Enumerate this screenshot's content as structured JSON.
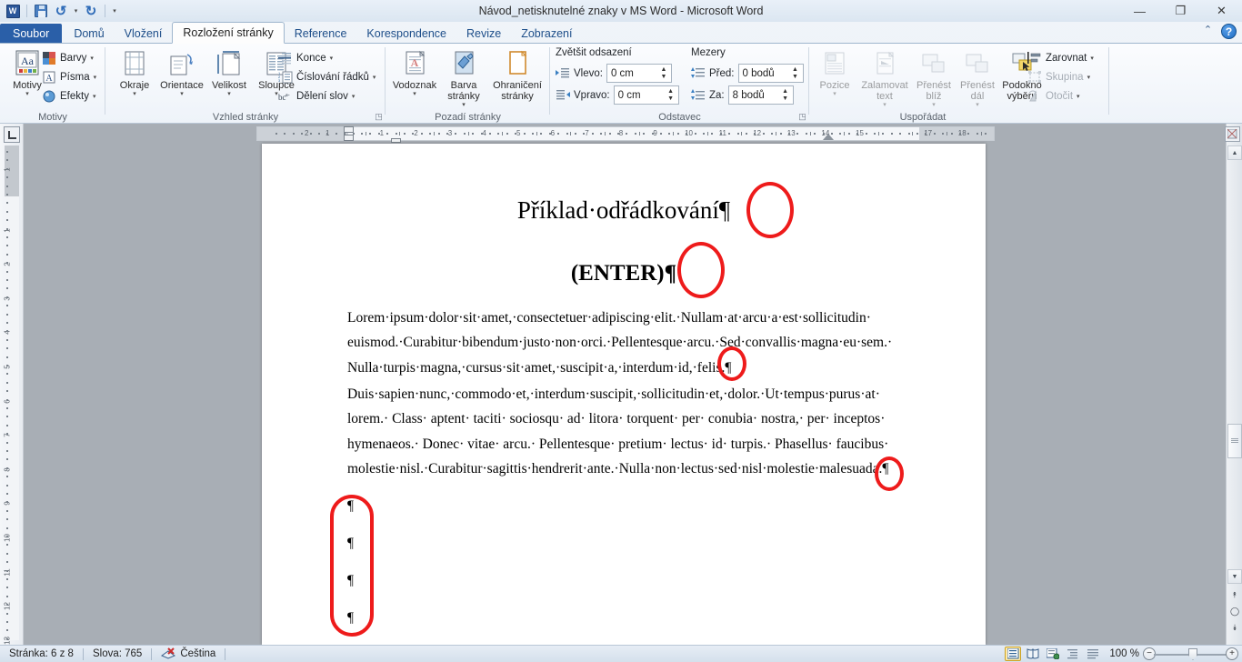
{
  "window": {
    "title": "Návod_netisknutelné znaky v MS Word  -  Microsoft Word",
    "minimize": "—",
    "restore": "❐",
    "close": "✕"
  },
  "quick_access": {
    "word_logo": "W",
    "save": "save-icon",
    "undo": "↺",
    "undo_caret": "▾",
    "redo": "↻",
    "customize_caret": "▾"
  },
  "tabs": [
    {
      "label": "Soubor",
      "active": false,
      "kind": "file"
    },
    {
      "label": "Domů",
      "active": false
    },
    {
      "label": "Vložení",
      "active": false
    },
    {
      "label": "Rozložení stránky",
      "active": true
    },
    {
      "label": "Reference",
      "active": false
    },
    {
      "label": "Korespondence",
      "active": false
    },
    {
      "label": "Revize",
      "active": false
    },
    {
      "label": "Zobrazení",
      "active": false
    }
  ],
  "help": {
    "minimize_ribbon": "⌃",
    "help_label": "?"
  },
  "ribbon": {
    "groups": [
      {
        "name": "Motivy",
        "big": [
          {
            "label": "Motivy",
            "caret": "▾"
          }
        ],
        "small": [
          {
            "label": "Barvy",
            "caret": "▾",
            "disabled": false
          },
          {
            "label": "Písma",
            "caret": "▾",
            "disabled": false
          },
          {
            "label": "Efekty",
            "caret": "▾",
            "disabled": false
          }
        ]
      },
      {
        "name": "Vzhled stránky",
        "big": [
          {
            "label": "Okraje",
            "caret": "▾"
          },
          {
            "label": "Orientace",
            "caret": "▾"
          },
          {
            "label": "Velikost",
            "caret": "▾"
          },
          {
            "label": "Sloupce",
            "caret": "▾"
          }
        ],
        "small": [
          {
            "label": "Konce",
            "caret": "▾"
          },
          {
            "label": "Číslování řádků",
            "caret": "▾"
          },
          {
            "label": "Dělení slov",
            "caret": "▾"
          }
        ],
        "dialog_launcher": "◳"
      },
      {
        "name": "Pozadí stránky",
        "big": [
          {
            "label": "Vodoznak",
            "caret": "▾"
          },
          {
            "label": "Barva stránky",
            "caret": "▾"
          },
          {
            "label": "Ohraničení stránky",
            "caret": ""
          }
        ]
      },
      {
        "name": "Odstavec",
        "subtitles": [
          "Zvětšit odsazení",
          "Mezery"
        ],
        "fields": [
          {
            "label": "Vlevo:",
            "value": "0 cm"
          },
          {
            "label": "Vpravo:",
            "value": "0 cm"
          },
          {
            "label": "Před:",
            "value": "0 bodů"
          },
          {
            "label": "Za:",
            "value": "8 bodů"
          }
        ],
        "dialog_launcher": "◳"
      },
      {
        "name": "Uspořádat",
        "big": [
          {
            "label": "Pozice",
            "caret": "▾",
            "disabled": true
          },
          {
            "label": "Zalamovat text",
            "caret": "▾",
            "disabled": true
          },
          {
            "label": "Přenést blíž",
            "caret": "▾",
            "disabled": true
          },
          {
            "label": "Přenést dál",
            "caret": "▾",
            "disabled": true
          },
          {
            "label": "Podokno výběru",
            "caret": "",
            "disabled": false
          }
        ],
        "small": [
          {
            "label": "Zarovnat",
            "caret": "▾",
            "disabled": false
          },
          {
            "label": "Skupina",
            "caret": "▾",
            "disabled": true
          },
          {
            "label": "Otočit",
            "caret": "▾",
            "disabled": true
          }
        ]
      }
    ]
  },
  "rulers": {
    "horizontal_ticks": [
      "2",
      "1",
      "1",
      "2",
      "3",
      "4",
      "5",
      "6",
      "7",
      "8",
      "9",
      "10",
      "11",
      "12",
      "13",
      "14",
      "15",
      "17",
      "18"
    ],
    "vertical_ticks": [
      "1",
      "1",
      "2",
      "3",
      "4",
      "5",
      "6",
      "7",
      "8",
      "9",
      "10",
      "11",
      "12",
      "13"
    ],
    "tab_selector": "left-tab-icon"
  },
  "document": {
    "heading1": "Příklad·odřádkování¶",
    "heading2": "(ENTER)¶",
    "paragraph1_lines": [
      "Lorem·ipsum·dolor·sit·amet,·consectetuer·adipiscing·elit.·Nullam·at·arcu·a·est·sollicitudin·",
      "euismod.·Curabitur·bibendum·justo·non·orci.·Pellentesque·arcu.·Sed·convallis·magna·eu·sem.·",
      "Nulla·turpis·magna,·cursus·sit·amet,·suscipit·a,·interdum·id,·felis.¶"
    ],
    "paragraph2_lines": [
      "Duis·sapien·nunc,·commodo·et,·interdum·suscipit,·sollicitudin·et,·dolor.·Ut·tempus·purus·at·",
      "lorem.· Class· aptent· taciti· sociosqu· ad· litora· torquent· per· conubia· nostra,· per· inceptos·",
      "hymenaeos.· Donec· vitae· arcu.· Pellentesque· pretium· lectus· id· turpis.· Phasellus· faucibus·",
      "molestie·nisl.·Curabitur·sagittis·hendrerit·ante.·Nulla·non·lectus·sed·nisl·molestie·malesuada.¶"
    ],
    "empty_paragraphs": [
      "¶",
      "¶",
      "¶",
      "¶"
    ],
    "annotation_color": "#ee1b1b"
  },
  "status_bar": {
    "page": "Stránka: 6 z 8",
    "words": "Slova: 765",
    "proofing_icon": "proofing-errors-icon",
    "language": "Čeština",
    "views": [
      {
        "name": "print-layout-view",
        "glyph": "▤",
        "active": true
      },
      {
        "name": "full-screen-reading-view",
        "glyph": "📖"
      },
      {
        "name": "web-layout-view",
        "glyph": "🖥"
      },
      {
        "name": "outline-view",
        "glyph": "☰"
      },
      {
        "name": "draft-view",
        "glyph": "≣"
      }
    ],
    "zoom": "100 %",
    "zoom_out": "−",
    "zoom_in": "+"
  },
  "scrollbar": {
    "up": "▲",
    "down": "▼",
    "prev_page": "⯭",
    "select_browse": "◯",
    "next_page": "⯯"
  }
}
